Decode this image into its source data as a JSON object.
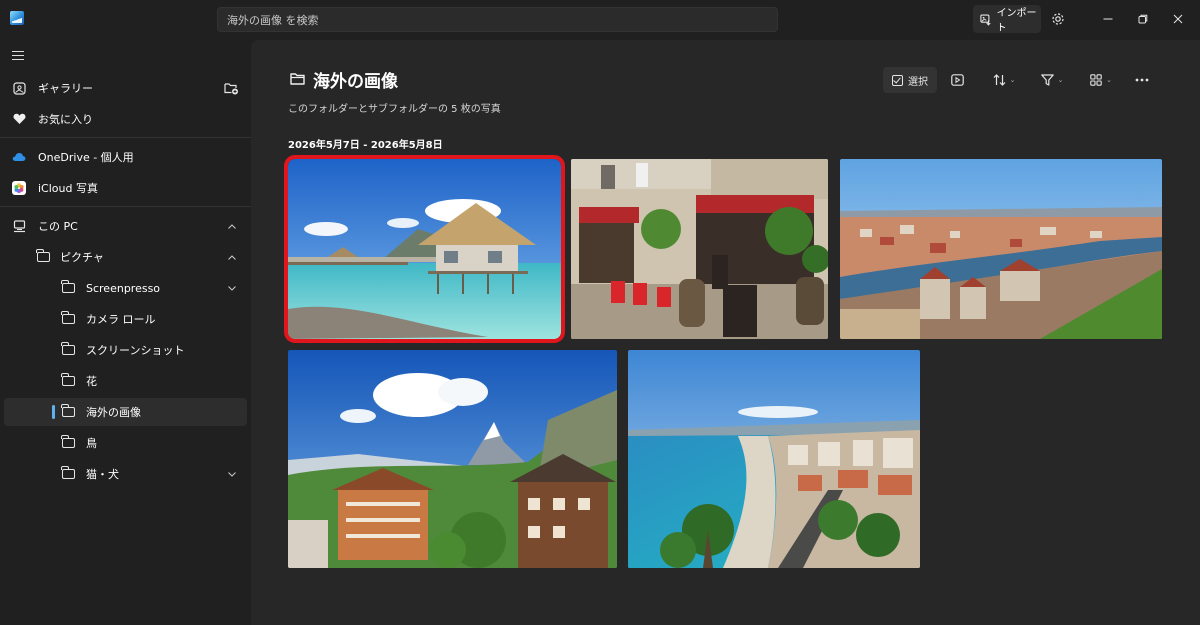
{
  "titlebar": {
    "search_placeholder": "海外の画像 を検索",
    "import_label": "インポート"
  },
  "sidebar": {
    "gallery": "ギャラリー",
    "favorites": "お気に入り",
    "onedrive": "OneDrive - 個人用",
    "icloud": "iCloud 写真",
    "this_pc": "この PC",
    "pictures": "ピクチャ",
    "folders": [
      "Screenpresso",
      "カメラ ロール",
      "スクリーンショット",
      "花",
      "海外の画像",
      "鳥",
      "猫・犬"
    ]
  },
  "main": {
    "title": "海外の画像",
    "subtitle": "このフォルダーとサブフォルダーの 5 枚の写真",
    "date_range": "2026年5月7日 - 2026年5月8日",
    "toolbar": {
      "select_label": "選択"
    }
  },
  "colors": {
    "selection_outline": "#e0161c",
    "accent": "#5fb2f2"
  },
  "icons": [
    "hamburger-icon",
    "gallery-icon",
    "heart-icon",
    "cloud-icon",
    "icloud-icon",
    "pc-icon",
    "folder-icon",
    "gear-icon",
    "slideshow-icon",
    "sort-icon",
    "filter-icon",
    "view-icon",
    "more-icon"
  ]
}
